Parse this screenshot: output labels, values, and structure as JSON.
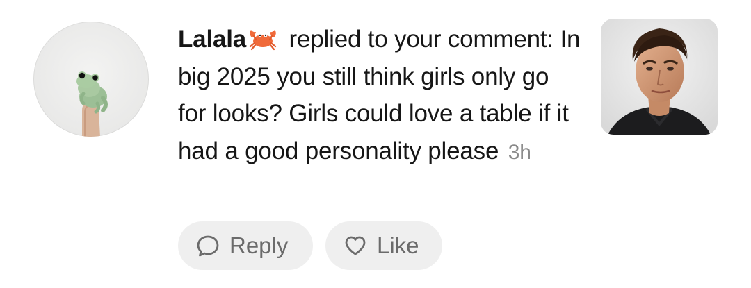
{
  "notification": {
    "username": "Lalala",
    "username_emoji": "crab-icon",
    "action_text": " replied to your comment: In big 2025 you still think girls only go for looks? Girls could love a table if it had a good personality please",
    "timestamp": "3h"
  },
  "actions": {
    "reply_label": "Reply",
    "reply_icon": "speech-bubble-icon",
    "like_label": "Like",
    "like_icon": "heart-outline-icon"
  },
  "colors": {
    "text": "#161616",
    "muted": "#8a8a8a",
    "button_bg": "#efefef",
    "button_text": "#6b6b6b",
    "crab": "#f06a3a"
  }
}
